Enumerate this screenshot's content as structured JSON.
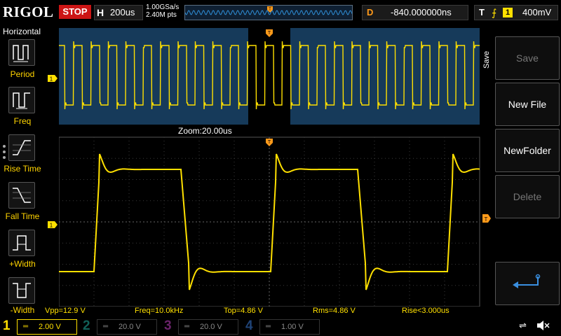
{
  "topbar": {
    "brand": "RIGOL",
    "run_state": "STOP",
    "timebase_letter": "H",
    "timebase": "200us",
    "sample_rate": "1.00GSa/s",
    "mem_depth": "2.40M pts",
    "delay_letter": "D",
    "delay": "-840.000000ns",
    "trigger_letter": "T",
    "trigger_source": "1",
    "trigger_level": "400mV"
  },
  "left_menu": {
    "title": "Horizontal",
    "items": [
      {
        "label": "Period",
        "icon": "period-icon"
      },
      {
        "label": "Freq",
        "icon": "freq-icon"
      },
      {
        "label": "Rise Time",
        "icon": "rise-time-icon"
      },
      {
        "label": "Fall Time",
        "icon": "fall-time-icon"
      },
      {
        "label": "+Width",
        "icon": "positive-width-icon"
      },
      {
        "label": "-Width",
        "icon": "negative-width-icon"
      }
    ]
  },
  "display": {
    "zoom_label": "Zoom:20.00us",
    "ch1_marker": "1",
    "trigger_marker": "T"
  },
  "measurements": {
    "vpp": "Vpp=12.9 V",
    "freq": "Freq=10.0kHz",
    "top": "Top=4.86 V",
    "rms": "Rms=4.86 V",
    "rise": "Rise<3.000us"
  },
  "right_menu": {
    "title": "Save",
    "buttons": [
      {
        "label": "Save",
        "enabled": false
      },
      {
        "label": "New File",
        "enabled": true
      },
      {
        "label": "NewFolder",
        "enabled": true
      },
      {
        "label": "Delete",
        "enabled": false
      }
    ]
  },
  "channels": [
    {
      "num": "1",
      "scale": "2.00 V",
      "color": "#ffe000",
      "active": true
    },
    {
      "num": "2",
      "scale": "20.0 V",
      "color": "#1fb0a0",
      "active": false
    },
    {
      "num": "3",
      "scale": "20.0 V",
      "color": "#c040c0",
      "active": false
    },
    {
      "num": "4",
      "scale": "1.00 V",
      "color": "#3a7ad8",
      "active": false
    }
  ],
  "colors": {
    "ch1": "#ffe000",
    "trigger": "#ff9a1a",
    "stop": "#cc1515",
    "overview_bg": "#163a5a",
    "right_button_text_enabled": "#ffffff"
  }
}
